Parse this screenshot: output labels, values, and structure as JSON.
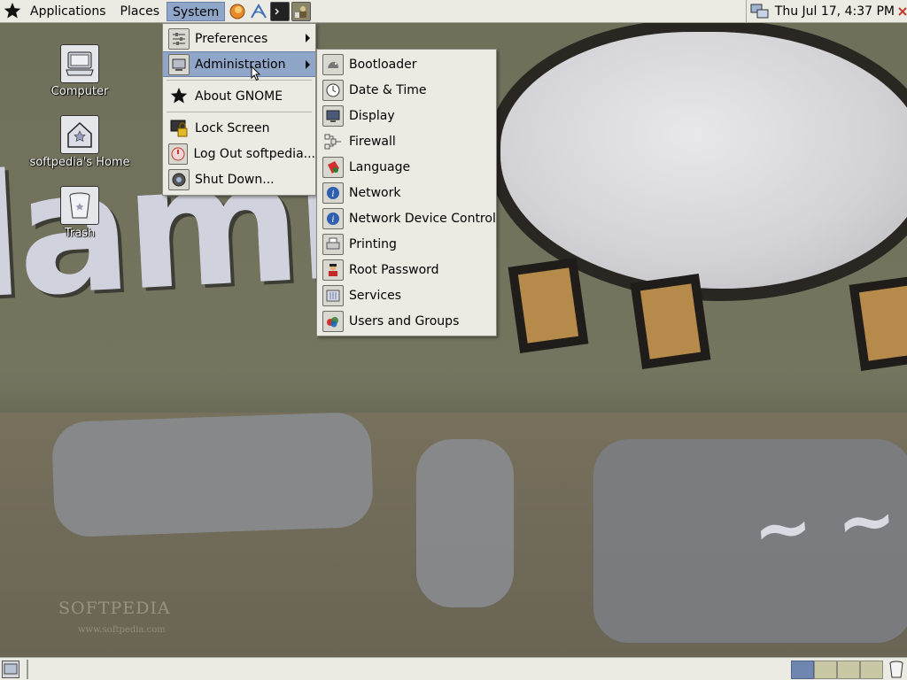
{
  "top_panel": {
    "applications_label": "Applications",
    "places_label": "Places",
    "system_label": "System",
    "launchers": [
      "firefox-icon",
      "evolution-icon",
      "terminal-icon",
      "user-switcher-icon"
    ],
    "clock": "Thu Jul 17,  4:37 PM"
  },
  "desktop_icons": [
    {
      "label": "Computer",
      "icon": "computer-icon"
    },
    {
      "label": "softpedia's Home",
      "icon": "home-folder-icon"
    },
    {
      "label": "Trash",
      "icon": "trash-icon"
    }
  ],
  "system_menu": {
    "items": [
      {
        "label": "Preferences",
        "icon": "preferences-icon",
        "submenu": true
      },
      {
        "label": "Administration",
        "icon": "administration-icon",
        "submenu": true,
        "highlighted": true
      },
      {
        "label": "About GNOME",
        "icon": "gnome-foot-icon"
      },
      {
        "label": "Lock Screen",
        "icon": "lock-icon"
      },
      {
        "label": "Log Out softpedia...",
        "icon": "logout-icon"
      },
      {
        "label": "Shut Down...",
        "icon": "shutdown-icon"
      }
    ]
  },
  "administration_menu": {
    "items": [
      {
        "label": "Bootloader",
        "icon": "bootloader-icon"
      },
      {
        "label": "Date & Time",
        "icon": "clock-icon"
      },
      {
        "label": "Display",
        "icon": "display-icon"
      },
      {
        "label": "Firewall",
        "icon": "firewall-icon"
      },
      {
        "label": "Language",
        "icon": "language-icon"
      },
      {
        "label": "Network",
        "icon": "network-info-icon"
      },
      {
        "label": "Network Device Control",
        "icon": "network-device-info-icon"
      },
      {
        "label": "Printing",
        "icon": "printer-icon"
      },
      {
        "label": "Root Password",
        "icon": "root-password-icon"
      },
      {
        "label": "Services",
        "icon": "services-icon"
      },
      {
        "label": "Users and Groups",
        "icon": "users-groups-icon"
      }
    ]
  },
  "watermark": {
    "brand": "SOFTPEDIA",
    "url": "www.softpedia.com"
  },
  "wallpaper_text": "lamb",
  "bottom_panel": {
    "workspaces": 4,
    "current_workspace": 1
  },
  "colors": {
    "panel_bg": "#ecebe3",
    "highlight": "#8fa6c8",
    "workspace_current": "#6f86b0"
  }
}
